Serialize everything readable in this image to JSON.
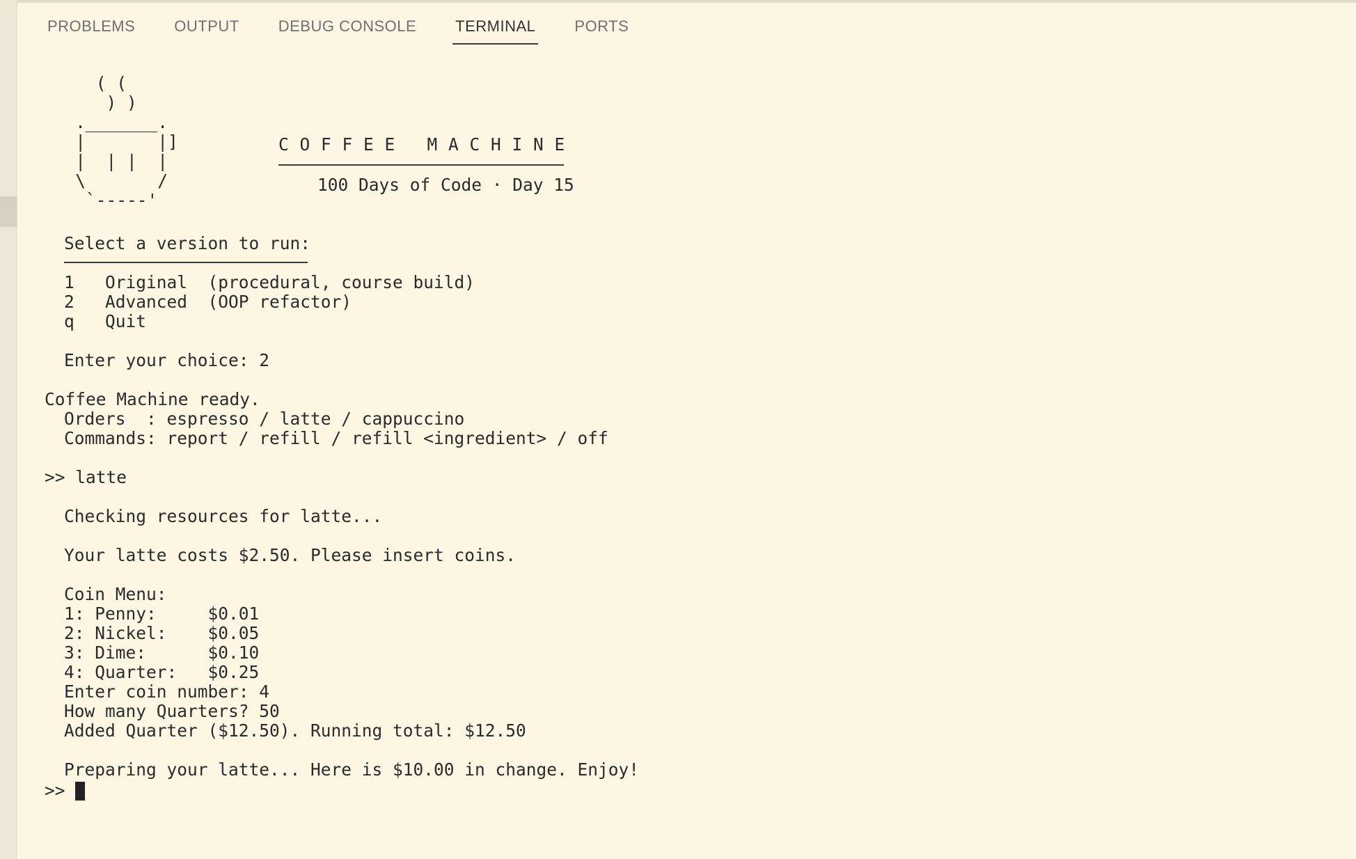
{
  "panel": {
    "tabs": [
      {
        "label": "PROBLEMS",
        "active": false
      },
      {
        "label": "OUTPUT",
        "active": false
      },
      {
        "label": "DEBUG CONSOLE",
        "active": false
      },
      {
        "label": "TERMINAL",
        "active": true
      },
      {
        "label": "PORTS",
        "active": false
      }
    ]
  },
  "terminal": {
    "ascii_art": "     ( (\n      ) )\n   ._______.\n   |       |]\n   |  | |  |\n   \\       /\n    `-----'",
    "banner_title": "C O F F E E   M A C H I N E",
    "banner_subtitle": "100 Days of Code · Day 15",
    "menu_heading": "Select a version to run:",
    "menu_options": [
      "1   Original  (procedural, course build)",
      "2   Advanced  (OOP refactor)",
      "q   Quit"
    ],
    "choice_line": "Enter your choice: 2",
    "ready_line": "Coffee Machine ready.",
    "orders_line": "Orders  : espresso / latte / cappuccino",
    "commands_line": "Commands: report / refill / refill <ingredient> / off",
    "input_line": ">> latte",
    "checking_line": "Checking resources for latte...",
    "cost_line": "Your latte costs $2.50. Please insert coins.",
    "coin_menu_heading": "Coin Menu:",
    "coin_menu": [
      "1: Penny:     $0.01",
      "2: Nickel:    $0.05",
      "3: Dime:      $0.10",
      "4: Quarter:   $0.25"
    ],
    "coin_number_line": "Enter coin number: 4",
    "how_many_line": "How many Quarters? 50",
    "added_line": "Added Quarter ($12.50). Running total: $12.50",
    "preparing_line": "Preparing your latte... Here is $10.00 in change. Enjoy!",
    "prompt": ">>"
  }
}
